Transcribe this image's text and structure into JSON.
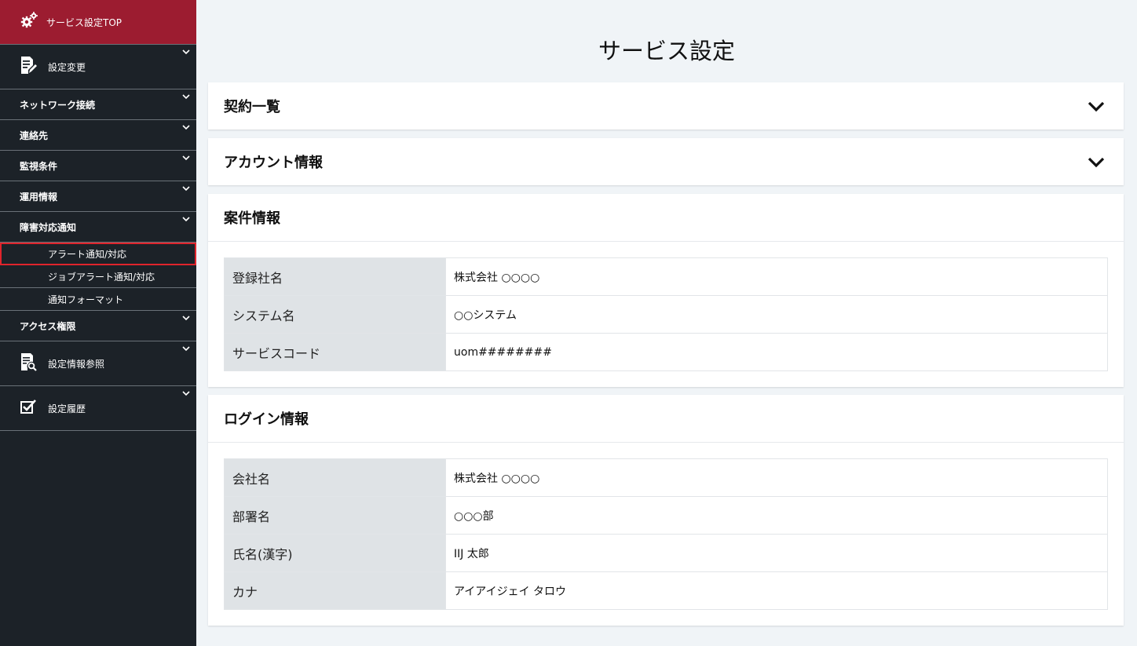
{
  "sidebar": {
    "top": {
      "label": "サービス設定TOP",
      "icon": "gears-icon"
    },
    "items": [
      {
        "label": "設定変更",
        "icon": "edit-document-icon"
      },
      {
        "label": "ネットワーク接続"
      },
      {
        "label": "連絡先"
      },
      {
        "label": "監視条件"
      },
      {
        "label": "運用情報"
      },
      {
        "label": "障害対応通知"
      },
      {
        "label": "アクセス権限"
      },
      {
        "label": "設定情報参照",
        "icon": "document-search-icon"
      },
      {
        "label": "設定履歴",
        "icon": "checkbox-icon"
      }
    ],
    "sub_items": [
      {
        "label": "アラート通知/対応",
        "active": true
      },
      {
        "label": "ジョブアラート通知/対応"
      },
      {
        "label": "通知フォーマット"
      }
    ]
  },
  "main": {
    "title": "サービス設定",
    "panels": {
      "contracts": {
        "title": "契約一覧"
      },
      "account": {
        "title": "アカウント情報"
      },
      "case": {
        "title": "案件情報",
        "rows": [
          {
            "label": "登録社名",
            "value": "株式会社 ○○○○"
          },
          {
            "label": "システム名",
            "value": "○○システム"
          },
          {
            "label": "サービスコード",
            "value": "uom########"
          }
        ]
      },
      "login": {
        "title": "ログイン情報",
        "rows": [
          {
            "label": "会社名",
            "value": "株式会社 ○○○○"
          },
          {
            "label": "部署名",
            "value": "○○○部"
          },
          {
            "label": "氏名(漢字)",
            "value": "IIJ 太郎"
          },
          {
            "label": "カナ",
            "value": "アイアイジェイ タロウ"
          }
        ]
      }
    }
  },
  "colors": {
    "sidebar_bg": "#1c2228",
    "sidebar_top_bg": "#9c1c30",
    "active_outline": "#e0242c",
    "page_bg": "#f0f4f7",
    "table_header_bg": "#dfe3e6"
  }
}
